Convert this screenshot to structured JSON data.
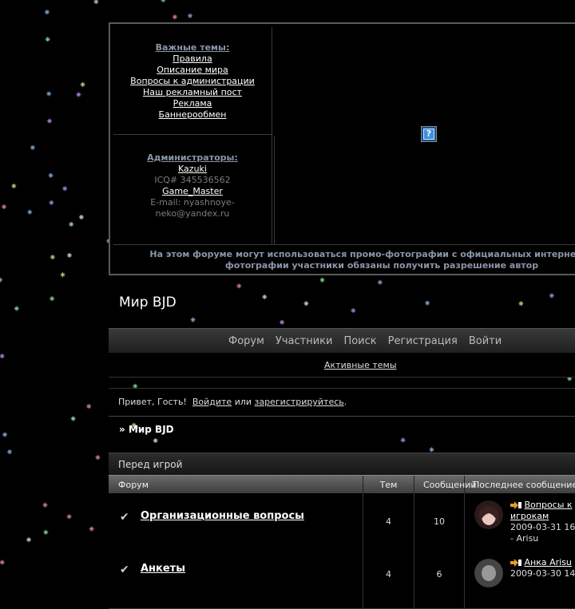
{
  "sidebar": {
    "important_title": "Важные темы:",
    "important_links": [
      "Правила",
      "Описание мира",
      "Вопросы к администрации",
      "Наш рекламный пост",
      "Реклама",
      "Баннерообмен"
    ],
    "admins_title": "Администраторы:",
    "admin1_name": "Kazuki",
    "admin1_contact": "ICQ# 345536562",
    "admin2_name": "Game_Master",
    "admin2_contact": "E-mail: nyashnoye-neko@yandex.ru"
  },
  "notice": {
    "line1": "На этом форуме могут использоваться промо-фотографии с официальных интернет-ма",
    "line2": "фотографии участники обязаны получить разрешение автор"
  },
  "forum": {
    "title": "Мир BJD"
  },
  "nav": {
    "items": [
      "Форум",
      "Участники",
      "Поиск",
      "Регистрация",
      "Войти"
    ],
    "active_topics": "Активные темы"
  },
  "greeting": {
    "hello": "Привет, Гость!",
    "login": "Войдите",
    "or": "или",
    "register": "зарегистрируйтесь",
    "dot": "."
  },
  "breadcrumb": "» Мир BJD",
  "category": {
    "title": "Перед игрой"
  },
  "table": {
    "headers": {
      "forum": "Форум",
      "topics": "Тем",
      "posts": "Сообщений",
      "last": "Последнее сообщение"
    },
    "rows": [
      {
        "name": "Организационные вопросы",
        "topics": "4",
        "posts": "10",
        "last_topic": "Вопросы к игрокам",
        "last_date": "2009-03-31 16",
        "last_author": "- Arisu"
      },
      {
        "name": "Анкеты",
        "topics": "4",
        "posts": "6",
        "last_topic": "Анка Arisu",
        "last_date": "2009-03-30 14",
        "last_author": ""
      }
    ]
  },
  "colors": {
    "background": "#000000",
    "accent_title": "#8a96a8",
    "text": "#dddddd"
  }
}
